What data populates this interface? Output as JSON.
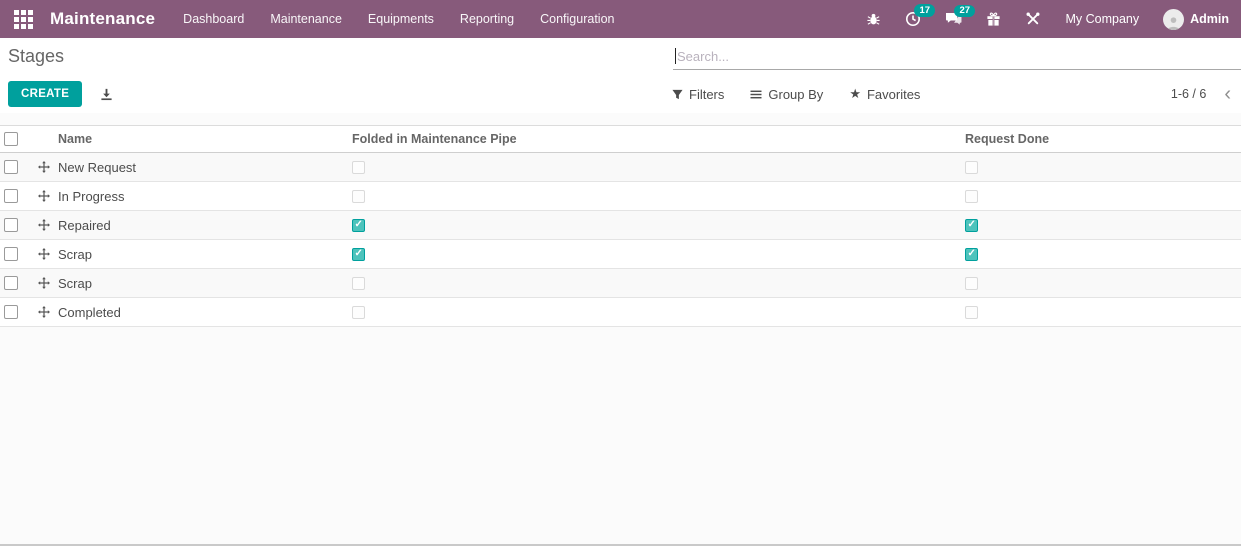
{
  "topbar": {
    "brand": "Maintenance",
    "menu": [
      "Dashboard",
      "Maintenance",
      "Equipments",
      "Reporting",
      "Configuration"
    ],
    "icons": {
      "bug": "debug-icon",
      "activities": "clock-icon",
      "messages": "chat-icon",
      "gift": "gift-icon",
      "tools": "tools-icon"
    },
    "activity_count": "17",
    "message_count": "27",
    "company": "My Company",
    "user": "Admin"
  },
  "control_panel": {
    "title": "Stages",
    "search_placeholder": "Search...",
    "create_label": "CREATE",
    "filters_label": "Filters",
    "group_by_label": "Group By",
    "favorites_label": "Favorites",
    "pager": "1-6 / 6"
  },
  "table": {
    "headers": {
      "name": "Name",
      "folded": "Folded in Maintenance Pipe",
      "done": "Request Done"
    },
    "rows": [
      {
        "name": "New Request",
        "folded": false,
        "done": false
      },
      {
        "name": "In Progress",
        "folded": false,
        "done": false
      },
      {
        "name": "Repaired",
        "folded": true,
        "done": true
      },
      {
        "name": "Scrap",
        "folded": true,
        "done": true
      },
      {
        "name": "Scrap",
        "folded": false,
        "done": false
      },
      {
        "name": "Completed",
        "folded": false,
        "done": false
      }
    ]
  },
  "colors": {
    "topbar": "#875a7b",
    "accent_teal": "#00a09d"
  }
}
